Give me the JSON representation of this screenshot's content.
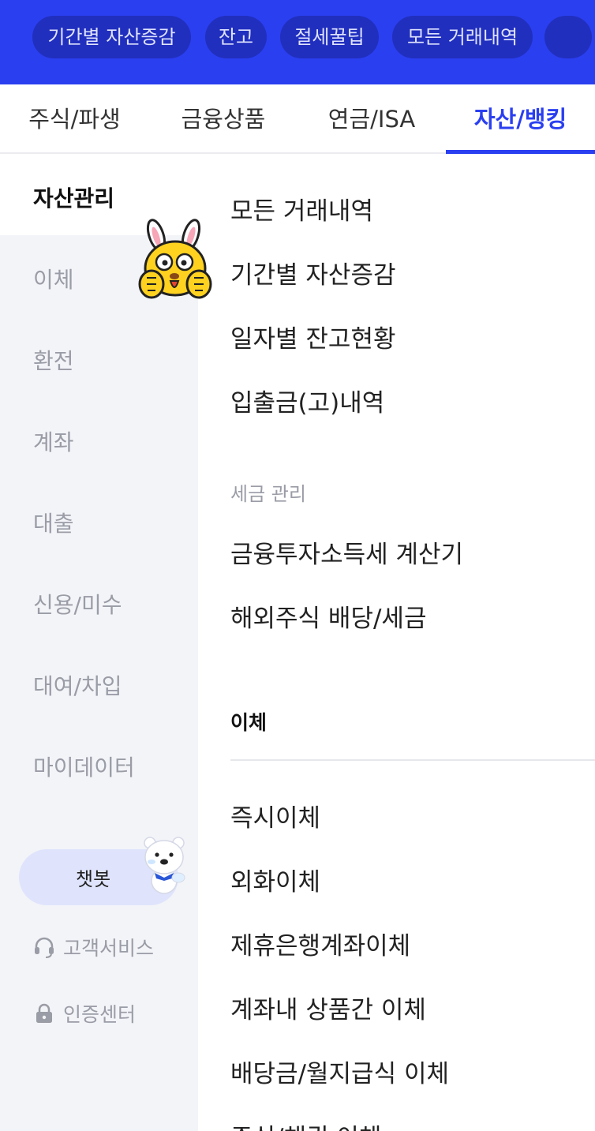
{
  "colors": {
    "brand": "#2a3ff0",
    "sidebar_bg": "#f3f4f8",
    "chatbot_bg": "#dfe4fc"
  },
  "chips": [
    {
      "label": "기간별 자산증감"
    },
    {
      "label": "잔고"
    },
    {
      "label": "절세꿀팁"
    },
    {
      "label": "모든 거래내역"
    }
  ],
  "tabs": [
    {
      "label": "주식/파생"
    },
    {
      "label": "금융상품"
    },
    {
      "label": "연금/ISA"
    },
    {
      "label": "자산/뱅킹",
      "active": true
    }
  ],
  "sidebar": {
    "items": [
      {
        "label": "자산관리",
        "active": true
      },
      {
        "label": "이체"
      },
      {
        "label": "환전"
      },
      {
        "label": "계좌"
      },
      {
        "label": "대출"
      },
      {
        "label": "신용/미수"
      },
      {
        "label": "대여/차입"
      },
      {
        "label": "마이데이터"
      }
    ],
    "chatbot_label": "챗봇",
    "customer_service": {
      "label": "고객서비스",
      "icon": "headset-icon"
    },
    "auth_center": {
      "label": "인증센터",
      "icon": "lock-icon"
    }
  },
  "menu": {
    "asset_items": [
      "모든 거래내역",
      "기간별 자산증감",
      "일자별 잔고현황",
      "입출금(고)내역"
    ],
    "tax_subtitle": "세금 관리",
    "tax_items": [
      "금융투자소득세 계산기",
      "해외주식 배당/세금"
    ],
    "transfer_title": "이체",
    "transfer_items": [
      "즉시이체",
      "외화이체",
      "제휴은행계좌이체",
      "계좌내 상품간 이체",
      "배당금/월지급식 이체",
      "주식/채권 이체"
    ]
  }
}
